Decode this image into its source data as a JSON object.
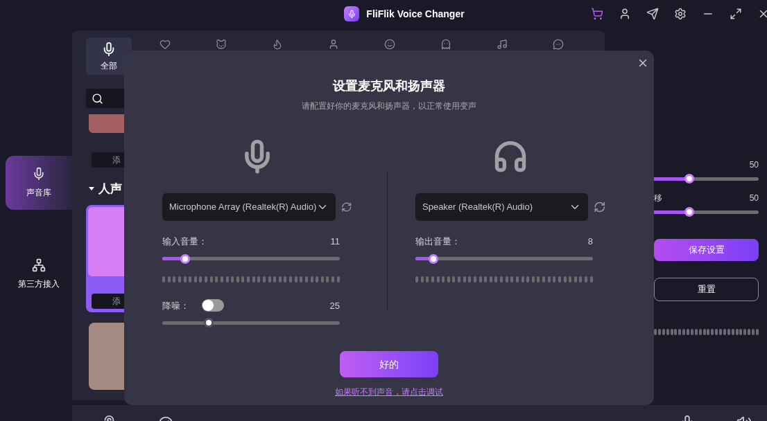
{
  "app": {
    "title": "FliFlik Voice Changer"
  },
  "sidebar": {
    "items": [
      {
        "label": "声音库",
        "selected": true
      },
      {
        "label": "第三方接入",
        "selected": false
      }
    ]
  },
  "categories": [
    {
      "label": "全部",
      "selected": true
    },
    {
      "selected": false
    },
    {
      "selected": false
    },
    {
      "selected": false
    },
    {
      "selected": false
    },
    {
      "selected": false
    },
    {
      "selected": false
    },
    {
      "selected": false
    },
    {
      "selected": false
    }
  ],
  "library": {
    "section": "人声",
    "cards": [
      {
        "color": "#a35f62",
        "add_button": "添"
      },
      {
        "color": "#d77ef5",
        "add_button": "添"
      },
      {
        "color": "#a38b84"
      }
    ]
  },
  "right_panel": {
    "sliders": [
      {
        "value": "50",
        "level": 0.5
      },
      {
        "label": "移",
        "value": "50",
        "level": 0.5
      }
    ],
    "save_button": "保存设置",
    "reset_button": "重置"
  },
  "dialog": {
    "title": "设置麦克风和扬声器",
    "subtitle": "请配置好你的麦克风和扬声器，以正常使用变声",
    "microphone": {
      "device": "Microphone Array (Realtek(R) Audio)",
      "volume_label": "输入音量：",
      "volume_value": "11",
      "level": 0.13,
      "noise": {
        "label": "降噪：",
        "on": false,
        "value": "25",
        "level": 0.26
      }
    },
    "speaker": {
      "device": "Speaker (Realtek(R) Audio)",
      "volume_label": "输出音量：",
      "volume_value": "8",
      "level": 0.1
    },
    "ok_button": "好的",
    "help_link": "如果听不到声音，请点击调试"
  }
}
